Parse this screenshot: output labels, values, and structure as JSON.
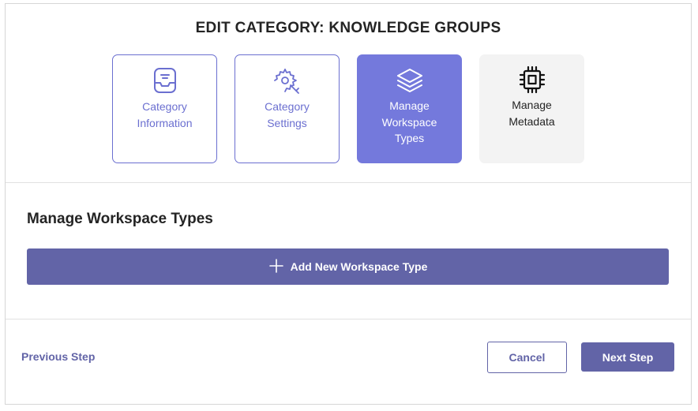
{
  "dialog": {
    "title": "EDIT CATEGORY: KNOWLEDGE GROUPS"
  },
  "steps": [
    {
      "line1": "Category",
      "line2": "Information",
      "line3": "",
      "icon": "inbox-tray-icon",
      "state": "completed"
    },
    {
      "line1": "Category",
      "line2": "Settings",
      "line3": "",
      "icon": "wrench-settings-icon",
      "state": "completed"
    },
    {
      "line1": "Manage",
      "line2": "Workspace",
      "line3": "Types",
      "icon": "layers-icon",
      "state": "active"
    },
    {
      "line1": "Manage",
      "line2": "Metadata",
      "line3": "",
      "icon": "chip-icon",
      "state": "pending"
    }
  ],
  "section": {
    "title": "Manage Workspace Types",
    "add_button_label": "Add New Workspace Type",
    "add_button_icon": "plus-icon"
  },
  "footer": {
    "previous_label": "Previous Step",
    "cancel_label": "Cancel",
    "next_label": "Next Step"
  },
  "colors": {
    "accent": "#6264a7",
    "step_border": "#6b6fd0",
    "step_active_bg": "#7479dc",
    "step_pending_bg": "#f3f3f3"
  }
}
